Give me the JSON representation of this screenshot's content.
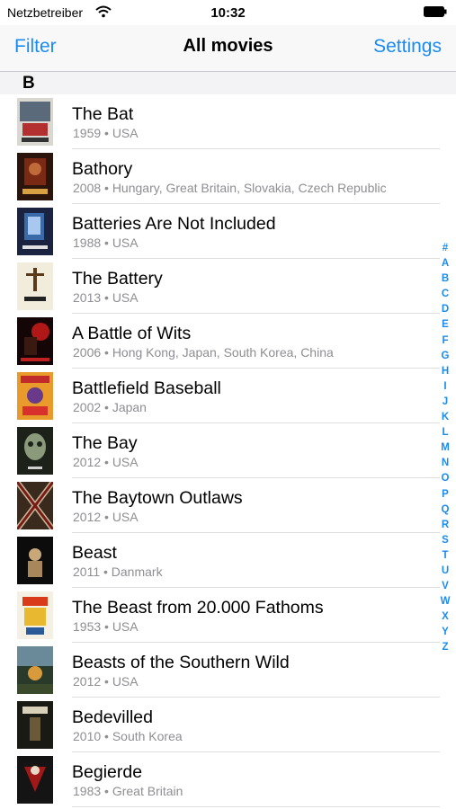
{
  "status_bar": {
    "carrier": "Netzbetreiber",
    "time": "10:32"
  },
  "nav": {
    "left_label": "Filter",
    "title": "All movies",
    "right_label": "Settings"
  },
  "section": {
    "letter": "B"
  },
  "movies": [
    {
      "title": "The Bat",
      "meta": "1959 • USA"
    },
    {
      "title": "Bathory",
      "meta": "2008 • Hungary, Great Britain, Slovakia, Czech Republic"
    },
    {
      "title": "Batteries Are Not Included",
      "meta": "1988 • USA"
    },
    {
      "title": "The Battery",
      "meta": "2013 • USA"
    },
    {
      "title": "A Battle of Wits",
      "meta": "2006 • Hong Kong, Japan, South Korea, China"
    },
    {
      "title": "Battlefield Baseball",
      "meta": "2002 • Japan"
    },
    {
      "title": "The Bay",
      "meta": "2012 • USA"
    },
    {
      "title": "The Baytown Outlaws",
      "meta": "2012 • USA"
    },
    {
      "title": "Beast",
      "meta": "2011 • Danmark"
    },
    {
      "title": "The Beast from 20.000 Fathoms",
      "meta": "1953 • USA"
    },
    {
      "title": "Beasts of the Southern Wild",
      "meta": "2012 • USA"
    },
    {
      "title": "Bedevilled",
      "meta": "2010 • South Korea"
    },
    {
      "title": "Begierde",
      "meta": "1983 • Great Britain"
    }
  ],
  "index_letters": [
    "#",
    "A",
    "B",
    "C",
    "D",
    "E",
    "F",
    "G",
    "H",
    "I",
    "J",
    "K",
    "L",
    "M",
    "N",
    "O",
    "P",
    "Q",
    "R",
    "S",
    "T",
    "U",
    "V",
    "W",
    "X",
    "Y",
    "Z"
  ],
  "colors": {
    "accent": "#1a8cf0",
    "meta_text": "#8e8e93"
  }
}
